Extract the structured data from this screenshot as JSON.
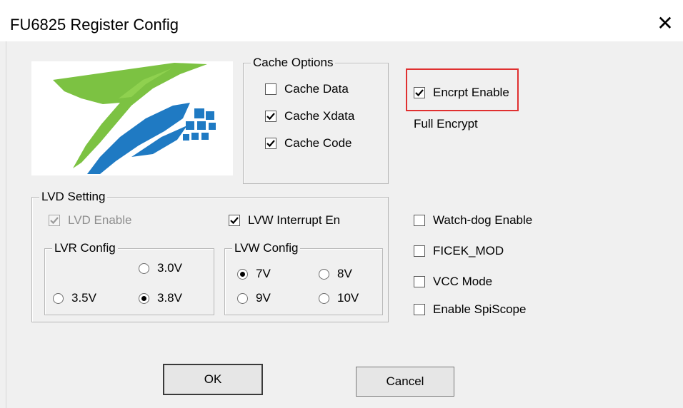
{
  "window": {
    "title": "FU6825 Register Config",
    "close_glyph": "✕"
  },
  "cache_options": {
    "label": "Cache Options",
    "items": [
      {
        "label": "Cache Data",
        "checked": false
      },
      {
        "label": "Cache Xdata",
        "checked": true
      },
      {
        "label": "Cache Code",
        "checked": true
      }
    ]
  },
  "encrypt": {
    "enable_label": "Encrpt Enable",
    "enable_checked": true,
    "mode_text": "Full Encrypt",
    "highlight_color": "#e03030"
  },
  "lvd": {
    "label": "LVD Setting",
    "lvd_enable_label": "LVD Enable",
    "lvd_enable_checked": true,
    "lvd_enable_disabled": true,
    "lvw_interrupt_label": "LVW Interrupt En",
    "lvw_interrupt_checked": true,
    "lvr_config": {
      "label": "LVR Config",
      "options": [
        "3.0V",
        "3.5V",
        "3.8V"
      ],
      "selected": "3.8V"
    },
    "lvw_config": {
      "label": "LVW Config",
      "options": [
        "7V",
        "8V",
        "9V",
        "10V"
      ],
      "selected": "7V"
    }
  },
  "options": [
    {
      "label": "Watch-dog Enable",
      "checked": false
    },
    {
      "label": "FICEK_MOD",
      "checked": false
    },
    {
      "label": "VCC Mode",
      "checked": false
    },
    {
      "label": "Enable SpiScope",
      "checked": false
    }
  ],
  "buttons": {
    "ok_label": "OK",
    "cancel_label": "Cancel"
  },
  "logo": {
    "icon": "company-logo",
    "colors": {
      "green": "#7cc242",
      "blue": "#1f7ac3"
    }
  }
}
